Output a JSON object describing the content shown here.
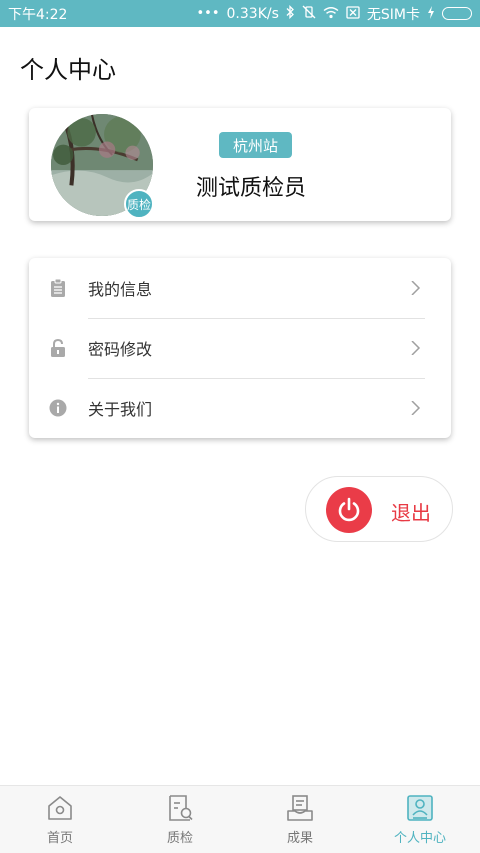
{
  "status_bar": {
    "time": "下午4:22",
    "network_speed": "0.33K/s",
    "sim": "无SIM卡",
    "icons": [
      "dots-icon",
      "bluetooth-icon",
      "vibrate-icon",
      "wifi-icon",
      "no-sim-icon",
      "charging-icon",
      "battery-icon"
    ],
    "battery_level": 1.0
  },
  "page": {
    "title": "个人中心"
  },
  "profile": {
    "station": "杭州站",
    "name": "测试质检员",
    "badge": "质检"
  },
  "menu": {
    "items": [
      {
        "label": "我的信息",
        "icon": "clipboard-icon"
      },
      {
        "label": "密码修改",
        "icon": "lock-icon"
      },
      {
        "label": "关于我们",
        "icon": "info-icon"
      }
    ]
  },
  "logout": {
    "label": "退出",
    "icon": "power-icon"
  },
  "bottom_nav": {
    "items": [
      {
        "label": "首页",
        "icon": "home-icon",
        "active": false
      },
      {
        "label": "质检",
        "icon": "inspection-icon",
        "active": false
      },
      {
        "label": "成果",
        "icon": "results-icon",
        "active": false
      },
      {
        "label": "个人中心",
        "icon": "profile-icon",
        "active": true
      }
    ]
  },
  "colors": {
    "accent": "#5fb8c2",
    "logout_red": "#ea3c48",
    "active_nav": "#4fb3c0"
  }
}
